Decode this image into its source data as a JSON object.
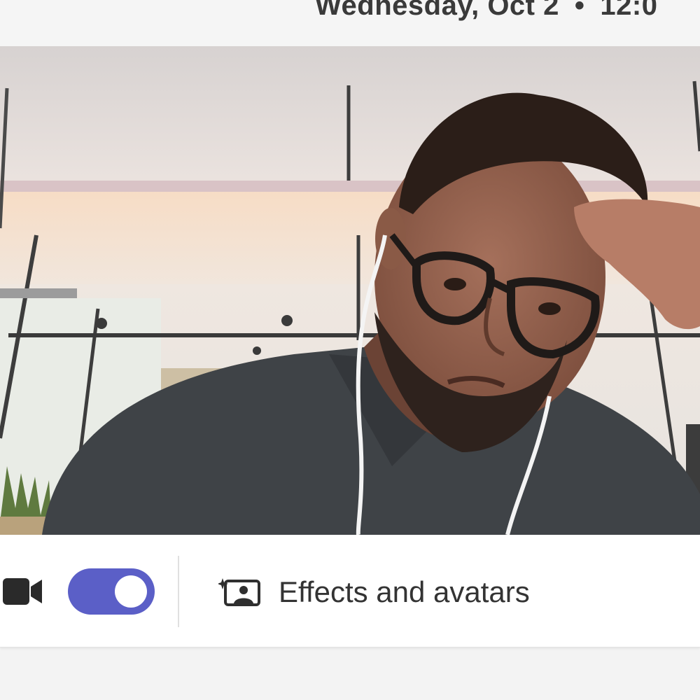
{
  "header": {
    "day": "Wednesday, Oct 2",
    "separator": "•",
    "time": "12:0"
  },
  "preview": {
    "label": "camera-preview"
  },
  "controls": {
    "camera_icon": "video-camera-icon",
    "camera_toggle_state": "on",
    "accent_color": "#5b5fc7",
    "effects_icon": "effects-avatar-icon",
    "effects_label": "Effects and avatars"
  }
}
